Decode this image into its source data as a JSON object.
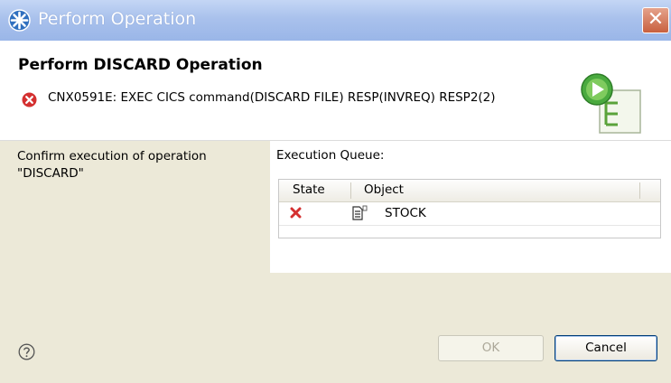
{
  "window": {
    "title": "Perform Operation",
    "close_glyph": "✕"
  },
  "header": {
    "title": "Perform DISCARD Operation",
    "error_message": "CNX0591E: EXEC CICS command(DISCARD FILE) RESP(INVREQ) RESP2(2)",
    "error_icon": "error-circle-icon",
    "wizard_icon": "run-operation-icon"
  },
  "left": {
    "confirm_text": "Confirm execution of operation \"DISCARD\""
  },
  "queue": {
    "label": "Execution Queue:",
    "columns": [
      "State",
      "Object"
    ],
    "rows": [
      {
        "state_icon": "failed-x-icon",
        "object_icon": "file-icon",
        "object": "STOCK"
      }
    ]
  },
  "buttons": {
    "ok": "OK",
    "cancel": "Cancel",
    "help_icon": "help-icon"
  },
  "colors": {
    "titlebar": "#a9c1ec",
    "panel": "#ece9d8",
    "error": "#d43030",
    "accent_green": "#3aa33a"
  }
}
